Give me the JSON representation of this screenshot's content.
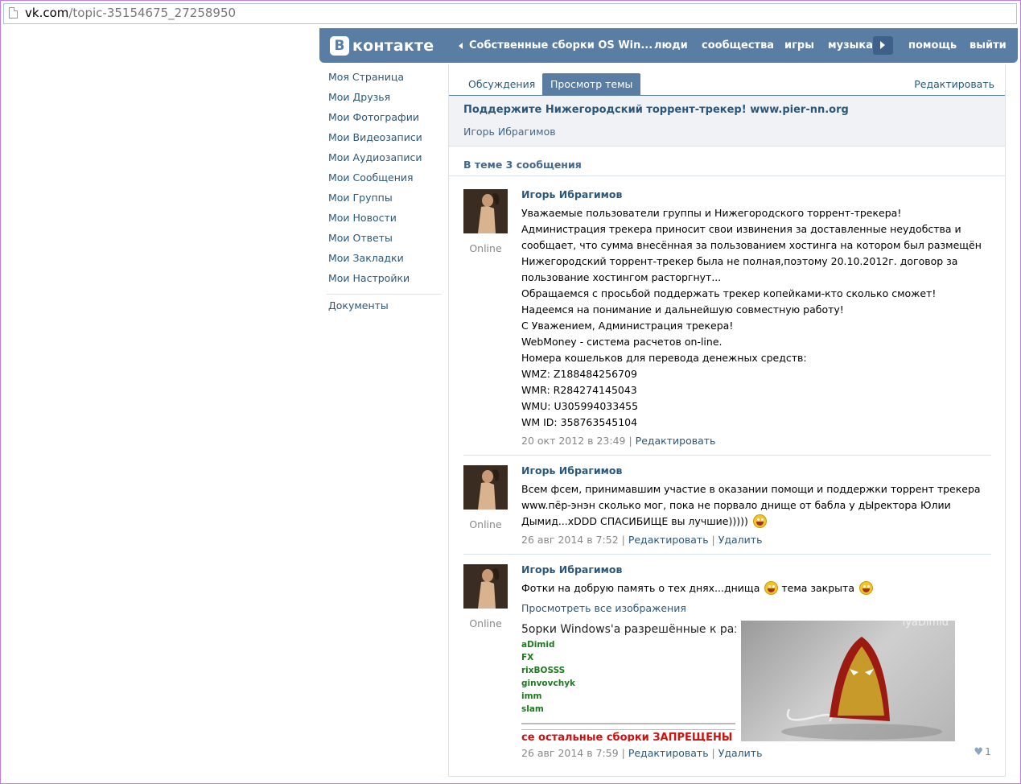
{
  "browser": {
    "url_domain": "vk.com",
    "url_path": "/topic-35154675_27258950"
  },
  "header": {
    "logo_letter": "В",
    "logo_text": "контакте",
    "back_label": "Собственные сборки OS Win...",
    "nav": [
      "люди",
      "сообщества",
      "игры",
      "музыка",
      "помощь",
      "выйти"
    ],
    "color": "#597da3"
  },
  "sidebar": {
    "items": [
      "Моя Страница",
      "Мои Друзья",
      "Мои Фотографии",
      "Мои Видеозаписи",
      "Мои Аудиозаписи",
      "Мои Сообщения",
      "Мои Группы",
      "Мои Новости",
      "Мои Ответы",
      "Мои Закладки",
      "Мои Настройки"
    ],
    "extra": "Документы"
  },
  "tabs": {
    "discussions": "Обсуждения",
    "view": "Просмотр темы",
    "edit": "Редактировать"
  },
  "topic": {
    "title": "Поддержите Нижегородский торрент-трекер! www.pier-nn.org",
    "author": "Игорь Ибрагимов",
    "count": "В теме 3 сообщения"
  },
  "posts": [
    {
      "author": "Игорь Ибрагимов",
      "status": "Online",
      "lines": [
        "Уважаемые пользователи группы и Нижегородского торрент-трекера!",
        "Администрация трекера приносит свои извинения за доставленные неудобства и",
        "сообщает, что сумма внесённая за пользованием хостинга на котором был размещён",
        "Нижегородский торрент-трекер была не полная,поэтому 20.10.2012г. договор за",
        "пользование хостингом расторгнут...",
        "Обращаемся с просьбой поддержать трекер копейками-кто сколько сможет!",
        "Надеемся на понимание и дальнейшую совместную работу!",
        "С Уважением, Администрация трекера!",
        "WebMoney - система расчетов on-line.",
        "Номера кошельков для перевода денежных средств:",
        "WMZ: Z188484256709",
        "WMR: R284274145043",
        "WMU: U305994033455",
        "WM ID: 358763545104"
      ],
      "date": "20 окт 2012 в 23:49",
      "sep": " | ",
      "edit": "Редактировать"
    },
    {
      "author": "Игорь Ибрагимов",
      "status": "Online",
      "lines": [
        "Всем фсем, принимавшим участие в оказании помощи и поддержки торрент трекера",
        "www.пёр-энэн сколько мог, пока не порвало днище от бабла у дЫректора Юлии",
        "Дымид...xDDD СПАСИБИЩЕ вы лучшие)))))"
      ],
      "date": "26 авг 2014 в 7:52",
      "sep": " | ",
      "edit": "Редактировать",
      "delete": "Удалить"
    },
    {
      "author": "Игорь Ибрагимов",
      "status": "Online",
      "text_a": "Фотки на добрую память о тех днях...днища",
      "text_b": "тема закрыта",
      "view_all": "Просмотреть все изображения",
      "attach_heading": "5орки Windows'a разрешённые к раздаче",
      "attach_names": [
        "aDimid",
        "FX",
        "rixBOSSS",
        "ginvovchyk",
        "imm",
        "slam"
      ],
      "attach_red": "се остальные сборки ЗАПРЕЩЕНЫ",
      "attach_watermark": "lyaDimid",
      "date": "26 авг 2014 в 7:59",
      "sep": " | ",
      "edit": "Редактировать",
      "delete": "Удалить",
      "likes": "1"
    }
  ]
}
